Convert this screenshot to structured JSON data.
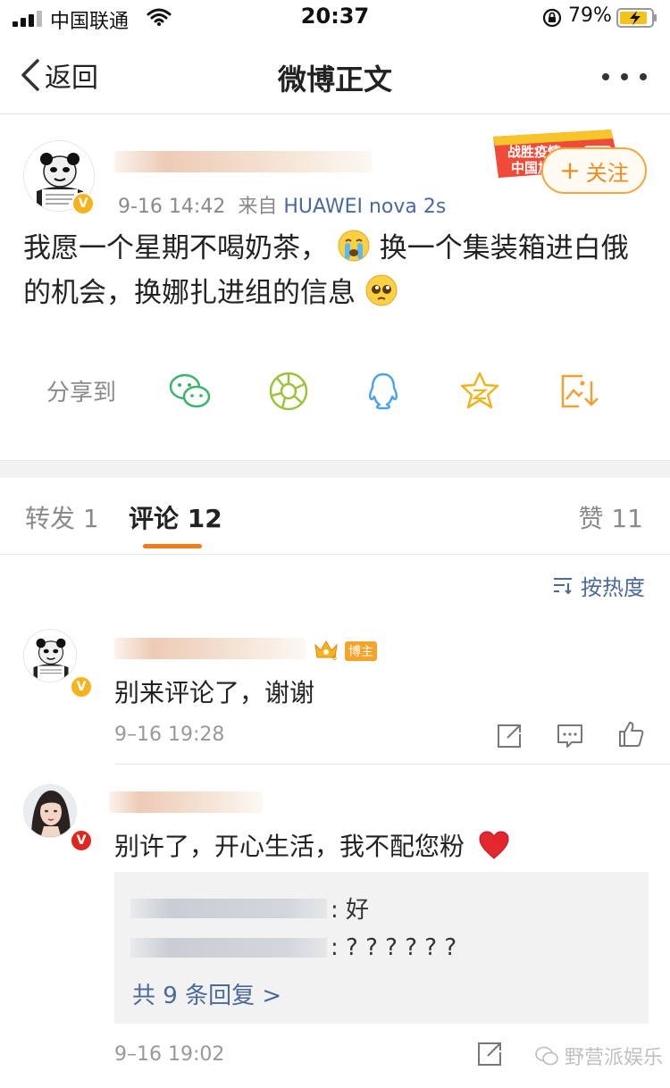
{
  "status_bar": {
    "carrier": "中国联通",
    "time": "20:37",
    "battery_percent": "79%",
    "icons": [
      "signal-icon",
      "wifi-icon",
      "orientation-lock-icon",
      "battery-charging-icon"
    ]
  },
  "nav": {
    "back_label": "返回",
    "title": "微博正文",
    "icons": [
      "chevron-left-icon",
      "more-icon"
    ]
  },
  "post": {
    "time": "9-16 14:42",
    "source_prefix": "来自",
    "source": "HUAWEI nova 2s",
    "follow_label": "关注",
    "campaign_badge": "战胜疫情 中国加油",
    "verified_badge": "V",
    "text_part1": "我愿一个星期不喝奶茶，",
    "text_part2": "换一个集装箱进白俄的机会，换娜扎进组的信息",
    "emojis": [
      "crying-face-emoji",
      "pleading-face-emoji"
    ],
    "share_label": "分享到",
    "share_icons": [
      "wechat-icon",
      "moments-icon",
      "qq-icon",
      "qzone-icon",
      "save-image-icon"
    ]
  },
  "tabs": {
    "repost": "转发 1",
    "comment": "评论 12",
    "like": "赞 11"
  },
  "sort": {
    "label": "按热度"
  },
  "comments": [
    {
      "badge": "博主",
      "verified_badge": "V",
      "text": "别来评论了，谢谢",
      "time": "9–16 19:28",
      "actions": [
        "repost-icon",
        "comment-icon",
        "like-icon"
      ]
    },
    {
      "verified_badge": "V",
      "text": "别许了，开心生活，我不配您粉",
      "emoji": "red-heart-emoji",
      "replies": [
        {
          "text": ": 好"
        },
        {
          "text": ": ? ? ? ? ? ?"
        }
      ],
      "more_replies": "共 9 条回复 >",
      "time": "9–16 19:02",
      "actions": [
        "repost-icon"
      ]
    }
  ],
  "watermark": {
    "text": "野营派娱乐"
  },
  "colors": {
    "accent_orange": "#f07d1a",
    "link_blue": "#4a6a9a",
    "verified_gold": "#f6b31d",
    "verified_red": "#e0271f"
  }
}
